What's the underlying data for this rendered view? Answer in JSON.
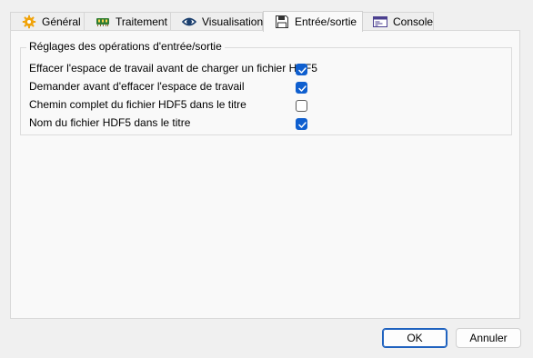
{
  "tabs": [
    {
      "label": "Général",
      "icon": "gear-icon"
    },
    {
      "label": "Traitement",
      "icon": "memory-chip-icon"
    },
    {
      "label": "Visualisation",
      "icon": "eye-icon"
    },
    {
      "label": "Entrée/sortie",
      "icon": "floppy-disk-icon",
      "active": true
    },
    {
      "label": "Console",
      "icon": "console-window-icon"
    }
  ],
  "group": {
    "title": "Réglages des opérations d'entrée/sortie",
    "options": [
      {
        "label": "Effacer l'espace de travail avant de charger un fichier HDF5",
        "checked": true
      },
      {
        "label": "Demander avant d'effacer l'espace de travail",
        "checked": true
      },
      {
        "label": "Chemin complet du fichier HDF5 dans le titre",
        "checked": false
      },
      {
        "label": "Nom du fichier HDF5 dans le titre",
        "checked": true
      }
    ]
  },
  "buttons": {
    "ok": "OK",
    "cancel": "Annuler"
  },
  "colors": {
    "accent": "#0f5fcf",
    "primary_border": "#1f62bf"
  }
}
